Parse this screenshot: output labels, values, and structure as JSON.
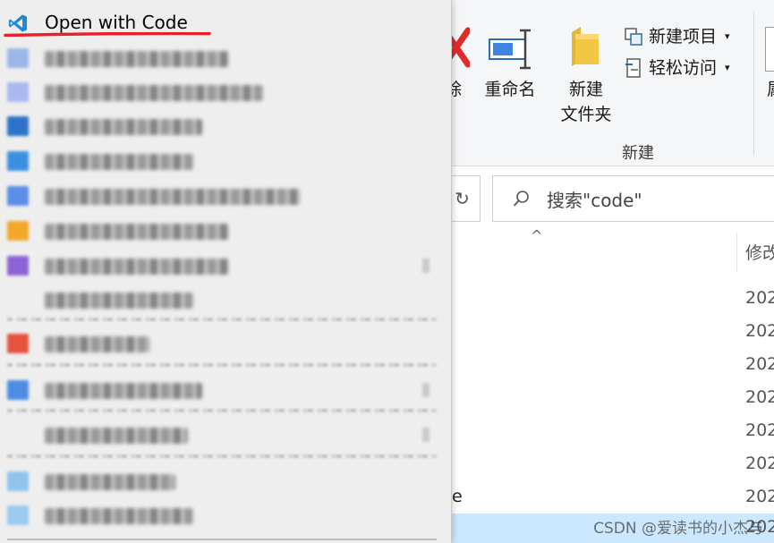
{
  "explorer": {
    "ribbon": {
      "delete_label": "除",
      "rename_label": "重命名",
      "new_folder_line1": "新建",
      "new_folder_line2": "文件夹",
      "new_item_label": "新建项目",
      "easy_access_label": "轻松访问",
      "new_group_label": "新建",
      "right_edge_label": "属"
    },
    "refresh_icon": "refresh-icon",
    "search": {
      "text": "搜索\"code\""
    },
    "column_header": "修改",
    "sort_caret": "^",
    "dates": [
      "202",
      "202",
      "202",
      "202",
      "202",
      "202",
      "202",
      "202"
    ],
    "name_fragment": "e"
  },
  "context_menu": {
    "primary_item": {
      "label": "Open with Code",
      "icon": "vscode-icon",
      "highlight_color": "#e8202a"
    },
    "blurred_item_count": 15
  },
  "watermark": "CSDN @爱读书的小杰与",
  "colors": {
    "vscode_blue": "#1f8ad2",
    "delete_red": "#e02b2b",
    "folder_yellow": "#f2c744",
    "selection_blue": "#cce8ff"
  }
}
